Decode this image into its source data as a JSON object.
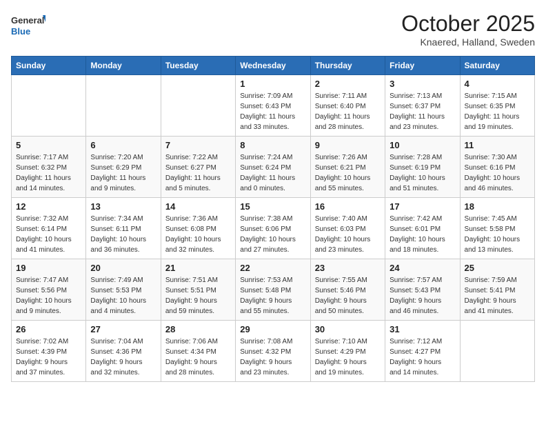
{
  "header": {
    "logo_general": "General",
    "logo_blue": "Blue",
    "month_title": "October 2025",
    "location": "Knaered, Halland, Sweden"
  },
  "weekdays": [
    "Sunday",
    "Monday",
    "Tuesday",
    "Wednesday",
    "Thursday",
    "Friday",
    "Saturday"
  ],
  "weeks": [
    [
      {
        "day": "",
        "info": ""
      },
      {
        "day": "",
        "info": ""
      },
      {
        "day": "",
        "info": ""
      },
      {
        "day": "1",
        "info": "Sunrise: 7:09 AM\nSunset: 6:43 PM\nDaylight: 11 hours\nand 33 minutes."
      },
      {
        "day": "2",
        "info": "Sunrise: 7:11 AM\nSunset: 6:40 PM\nDaylight: 11 hours\nand 28 minutes."
      },
      {
        "day": "3",
        "info": "Sunrise: 7:13 AM\nSunset: 6:37 PM\nDaylight: 11 hours\nand 23 minutes."
      },
      {
        "day": "4",
        "info": "Sunrise: 7:15 AM\nSunset: 6:35 PM\nDaylight: 11 hours\nand 19 minutes."
      }
    ],
    [
      {
        "day": "5",
        "info": "Sunrise: 7:17 AM\nSunset: 6:32 PM\nDaylight: 11 hours\nand 14 minutes."
      },
      {
        "day": "6",
        "info": "Sunrise: 7:20 AM\nSunset: 6:29 PM\nDaylight: 11 hours\nand 9 minutes."
      },
      {
        "day": "7",
        "info": "Sunrise: 7:22 AM\nSunset: 6:27 PM\nDaylight: 11 hours\nand 5 minutes."
      },
      {
        "day": "8",
        "info": "Sunrise: 7:24 AM\nSunset: 6:24 PM\nDaylight: 11 hours\nand 0 minutes."
      },
      {
        "day": "9",
        "info": "Sunrise: 7:26 AM\nSunset: 6:21 PM\nDaylight: 10 hours\nand 55 minutes."
      },
      {
        "day": "10",
        "info": "Sunrise: 7:28 AM\nSunset: 6:19 PM\nDaylight: 10 hours\nand 51 minutes."
      },
      {
        "day": "11",
        "info": "Sunrise: 7:30 AM\nSunset: 6:16 PM\nDaylight: 10 hours\nand 46 minutes."
      }
    ],
    [
      {
        "day": "12",
        "info": "Sunrise: 7:32 AM\nSunset: 6:14 PM\nDaylight: 10 hours\nand 41 minutes."
      },
      {
        "day": "13",
        "info": "Sunrise: 7:34 AM\nSunset: 6:11 PM\nDaylight: 10 hours\nand 36 minutes."
      },
      {
        "day": "14",
        "info": "Sunrise: 7:36 AM\nSunset: 6:08 PM\nDaylight: 10 hours\nand 32 minutes."
      },
      {
        "day": "15",
        "info": "Sunrise: 7:38 AM\nSunset: 6:06 PM\nDaylight: 10 hours\nand 27 minutes."
      },
      {
        "day": "16",
        "info": "Sunrise: 7:40 AM\nSunset: 6:03 PM\nDaylight: 10 hours\nand 23 minutes."
      },
      {
        "day": "17",
        "info": "Sunrise: 7:42 AM\nSunset: 6:01 PM\nDaylight: 10 hours\nand 18 minutes."
      },
      {
        "day": "18",
        "info": "Sunrise: 7:45 AM\nSunset: 5:58 PM\nDaylight: 10 hours\nand 13 minutes."
      }
    ],
    [
      {
        "day": "19",
        "info": "Sunrise: 7:47 AM\nSunset: 5:56 PM\nDaylight: 10 hours\nand 9 minutes."
      },
      {
        "day": "20",
        "info": "Sunrise: 7:49 AM\nSunset: 5:53 PM\nDaylight: 10 hours\nand 4 minutes."
      },
      {
        "day": "21",
        "info": "Sunrise: 7:51 AM\nSunset: 5:51 PM\nDaylight: 9 hours\nand 59 minutes."
      },
      {
        "day": "22",
        "info": "Sunrise: 7:53 AM\nSunset: 5:48 PM\nDaylight: 9 hours\nand 55 minutes."
      },
      {
        "day": "23",
        "info": "Sunrise: 7:55 AM\nSunset: 5:46 PM\nDaylight: 9 hours\nand 50 minutes."
      },
      {
        "day": "24",
        "info": "Sunrise: 7:57 AM\nSunset: 5:43 PM\nDaylight: 9 hours\nand 46 minutes."
      },
      {
        "day": "25",
        "info": "Sunrise: 7:59 AM\nSunset: 5:41 PM\nDaylight: 9 hours\nand 41 minutes."
      }
    ],
    [
      {
        "day": "26",
        "info": "Sunrise: 7:02 AM\nSunset: 4:39 PM\nDaylight: 9 hours\nand 37 minutes."
      },
      {
        "day": "27",
        "info": "Sunrise: 7:04 AM\nSunset: 4:36 PM\nDaylight: 9 hours\nand 32 minutes."
      },
      {
        "day": "28",
        "info": "Sunrise: 7:06 AM\nSunset: 4:34 PM\nDaylight: 9 hours\nand 28 minutes."
      },
      {
        "day": "29",
        "info": "Sunrise: 7:08 AM\nSunset: 4:32 PM\nDaylight: 9 hours\nand 23 minutes."
      },
      {
        "day": "30",
        "info": "Sunrise: 7:10 AM\nSunset: 4:29 PM\nDaylight: 9 hours\nand 19 minutes."
      },
      {
        "day": "31",
        "info": "Sunrise: 7:12 AM\nSunset: 4:27 PM\nDaylight: 9 hours\nand 14 minutes."
      },
      {
        "day": "",
        "info": ""
      }
    ]
  ]
}
